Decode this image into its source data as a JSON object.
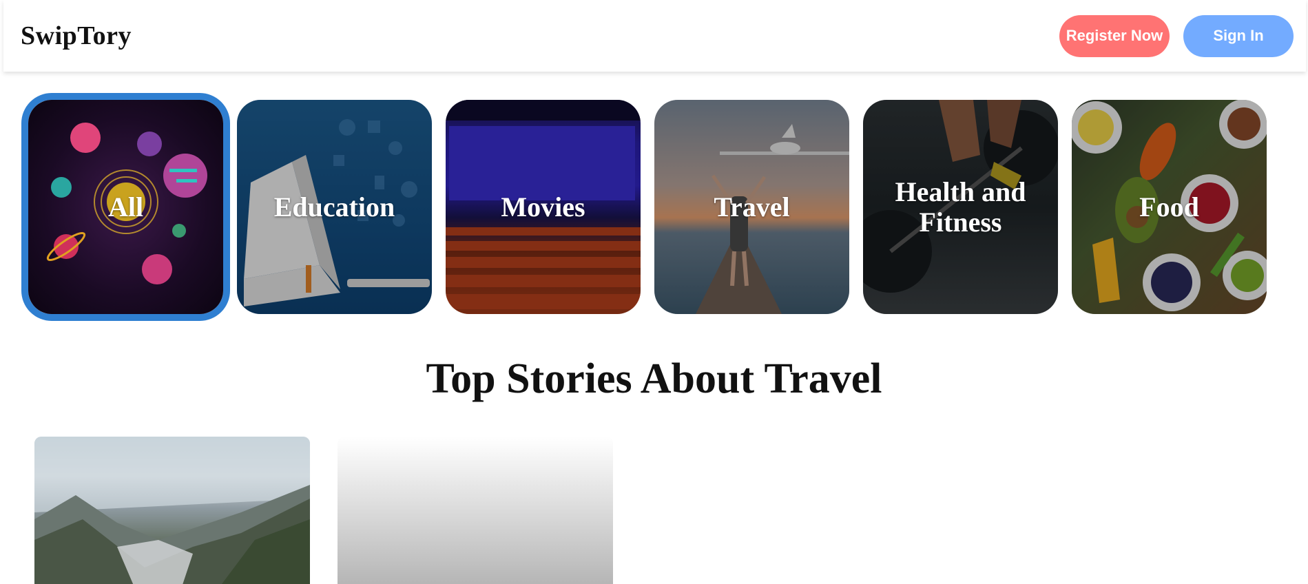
{
  "header": {
    "logo": "SwipTory",
    "register_label": "Register Now",
    "signin_label": "Sign In"
  },
  "categories": [
    {
      "label": "All",
      "selected": true
    },
    {
      "label": "Education",
      "selected": false
    },
    {
      "label": "Movies",
      "selected": false
    },
    {
      "label": "Travel",
      "selected": false
    },
    {
      "label": "Health and Fitness",
      "selected": false
    },
    {
      "label": "Food",
      "selected": false
    }
  ],
  "section": {
    "title": "Top Stories About Travel"
  },
  "colors": {
    "register": "#ff7373",
    "signin": "#73abff",
    "selected_outline": "#2f7fd1"
  }
}
